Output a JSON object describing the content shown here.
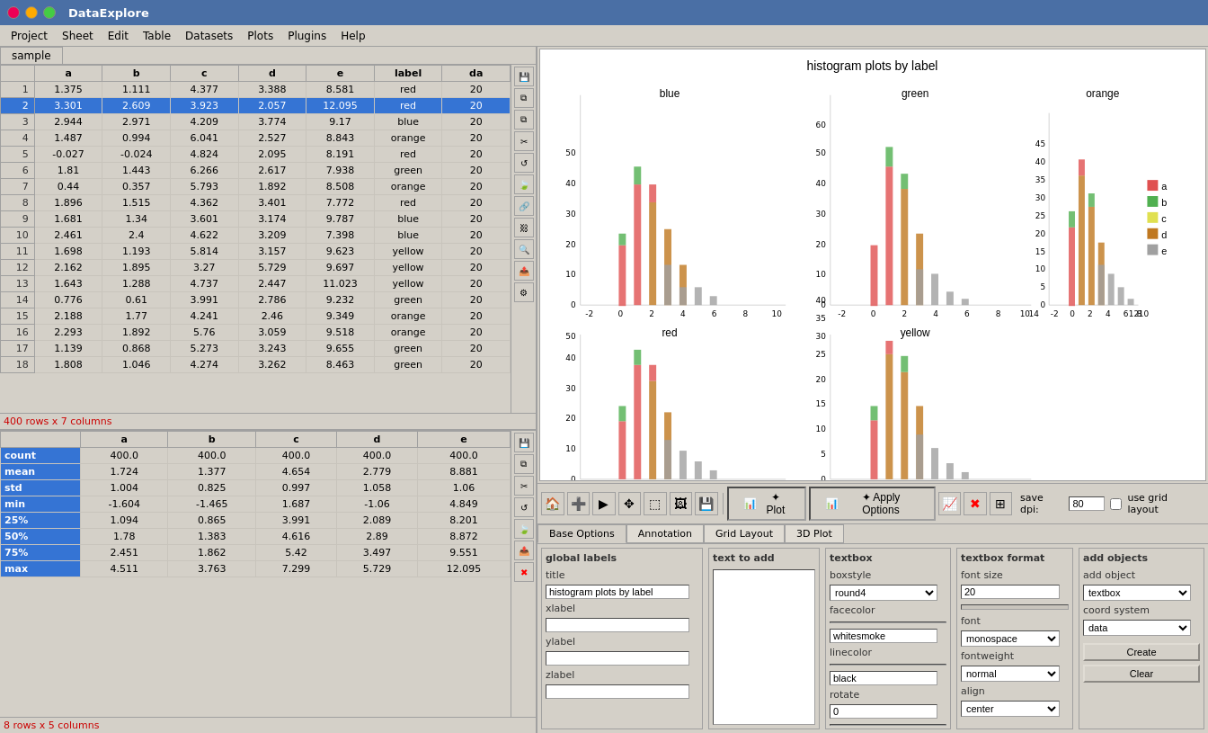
{
  "app": {
    "title": "DataExplore",
    "tab": "sample"
  },
  "menu": {
    "items": [
      "Project",
      "Sheet",
      "Edit",
      "Table",
      "Datasets",
      "Plots",
      "Plugins",
      "Help"
    ]
  },
  "data_table": {
    "columns": [
      "a",
      "b",
      "c",
      "d",
      "e",
      "label",
      "da"
    ],
    "rows": [
      [
        1,
        "1.375",
        "1.111",
        "4.377",
        "3.388",
        "8.581",
        "red",
        "20"
      ],
      [
        2,
        "3.301",
        "2.609",
        "3.923",
        "2.057",
        "12.095",
        "red",
        "20"
      ],
      [
        3,
        "2.944",
        "2.971",
        "4.209",
        "3.774",
        "9.17",
        "blue",
        "20"
      ],
      [
        4,
        "1.487",
        "0.994",
        "6.041",
        "2.527",
        "8.843",
        "orange",
        "20"
      ],
      [
        5,
        "-0.027",
        "-0.024",
        "4.824",
        "2.095",
        "8.191",
        "red",
        "20"
      ],
      [
        6,
        "1.81",
        "1.443",
        "6.266",
        "2.617",
        "7.938",
        "green",
        "20"
      ],
      [
        7,
        "0.44",
        "0.357",
        "5.793",
        "1.892",
        "8.508",
        "orange",
        "20"
      ],
      [
        8,
        "1.896",
        "1.515",
        "4.362",
        "3.401",
        "7.772",
        "red",
        "20"
      ],
      [
        9,
        "1.681",
        "1.34",
        "3.601",
        "3.174",
        "9.787",
        "blue",
        "20"
      ],
      [
        10,
        "2.461",
        "2.4",
        "4.622",
        "3.209",
        "7.398",
        "blue",
        "20"
      ],
      [
        11,
        "1.698",
        "1.193",
        "5.814",
        "3.157",
        "9.623",
        "yellow",
        "20"
      ],
      [
        12,
        "2.162",
        "1.895",
        "3.27",
        "5.729",
        "9.697",
        "yellow",
        "20"
      ],
      [
        13,
        "1.643",
        "1.288",
        "4.737",
        "2.447",
        "11.023",
        "yellow",
        "20"
      ],
      [
        14,
        "0.776",
        "0.61",
        "3.991",
        "2.786",
        "9.232",
        "green",
        "20"
      ],
      [
        15,
        "2.188",
        "1.77",
        "4.241",
        "2.46",
        "9.349",
        "orange",
        "20"
      ],
      [
        16,
        "2.293",
        "1.892",
        "5.76",
        "3.059",
        "9.518",
        "orange",
        "20"
      ],
      [
        17,
        "1.139",
        "0.868",
        "5.273",
        "3.243",
        "9.655",
        "green",
        "20"
      ],
      [
        18,
        "1.808",
        "1.046",
        "4.274",
        "3.262",
        "8.463",
        "green",
        "20"
      ]
    ],
    "row_info": "400 rows x 7 columns"
  },
  "stats_table": {
    "columns": [
      "a",
      "b",
      "c",
      "d",
      "e"
    ],
    "rows": [
      [
        "count",
        "400.0",
        "400.0",
        "400.0",
        "400.0",
        "400.0"
      ],
      [
        "mean",
        "1.724",
        "1.377",
        "4.654",
        "2.779",
        "8.881"
      ],
      [
        "std",
        "1.004",
        "0.825",
        "0.997",
        "1.058",
        "1.06"
      ],
      [
        "min",
        "-1.604",
        "-1.465",
        "1.687",
        "-1.06",
        "4.849"
      ],
      [
        "25%",
        "1.094",
        "0.865",
        "3.991",
        "2.089",
        "8.201"
      ],
      [
        "50%",
        "1.78",
        "1.383",
        "4.616",
        "2.89",
        "8.872"
      ],
      [
        "75%",
        "2.451",
        "1.862",
        "5.42",
        "3.497",
        "9.551"
      ],
      [
        "max",
        "4.511",
        "3.763",
        "7.299",
        "5.729",
        "12.095"
      ]
    ],
    "row_info": "8 rows x 5 columns"
  },
  "plot": {
    "title": "histogram plots by label",
    "subplots": [
      "blue",
      "green",
      "orange",
      "red",
      "yellow"
    ]
  },
  "toolbar": {
    "plot_label": "✦ Plot",
    "apply_label": "✦ Apply Options",
    "save_dpi_label": "save dpi:",
    "save_dpi_value": "80",
    "use_grid_label": "use grid layout"
  },
  "options_tabs": {
    "tabs": [
      "Base Options",
      "Annotation",
      "Grid Layout",
      "3D Plot"
    ]
  },
  "base_options": {
    "global_labels_title": "global labels",
    "title_label": "title",
    "title_value": "histogram plots by label",
    "xlabel_label": "xlabel",
    "xlabel_value": "",
    "ylabel_label": "ylabel",
    "ylabel_value": "",
    "zlabel_label": "zlabel",
    "zlabel_value": ""
  },
  "textbox_section": {
    "title": "textbox",
    "boxstyle_label": "boxstyle",
    "boxstyle_value": "round4",
    "facecolor_label": "facecolor",
    "facecolor_value": "whitesmoke",
    "linecolor_label": "linecolor",
    "linecolor_value": "black",
    "rotate_label": "rotate",
    "rotate_value": "0"
  },
  "textbox_format": {
    "title": "textbox format",
    "font_size_label": "font size",
    "font_size_value": "20",
    "font_label": "font",
    "font_value": "monospace",
    "fontweight_label": "fontweight",
    "fontweight_value": "normal",
    "align_label": "align",
    "align_value": "center"
  },
  "add_objects": {
    "title": "add objects",
    "add_object_label": "add object",
    "add_object_value": "textbox",
    "coord_system_label": "coord system",
    "coord_system_value": "data",
    "create_label": "Create",
    "clear_label": "Clear"
  },
  "text_to_add": {
    "title": "text to add"
  },
  "icons": {
    "home": "🏠",
    "add": "➕",
    "forward": "▶",
    "move": "✥",
    "select": "⬚",
    "image": "🖼",
    "save": "💾",
    "copy": "⧉",
    "copy2": "⧉",
    "scissors": "✂",
    "refresh": "↺",
    "leaf": "🍃",
    "link": "🔗",
    "unlink": "⛓",
    "zoom": "🔍",
    "export": "📤",
    "filter": "⚙",
    "red_x": "✖",
    "grid": "⊞",
    "settings": "⚙",
    "plot_icon": "📊"
  }
}
